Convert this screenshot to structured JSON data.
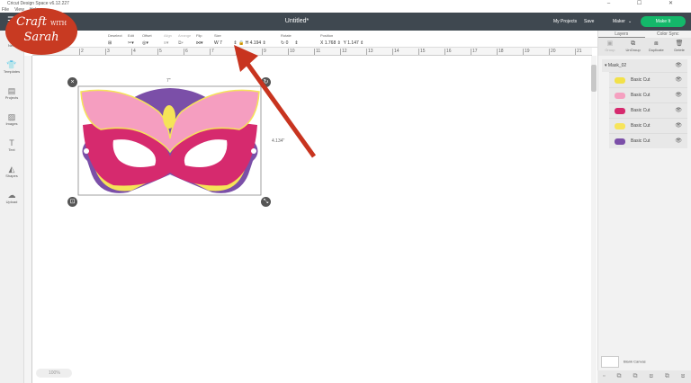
{
  "window": {
    "title": "Cricut Design Space v6.12.227",
    "controls": "– ☐ ✕"
  },
  "menu": [
    "File",
    "View",
    "Help"
  ],
  "header": {
    "title": "Untitled*",
    "my_projects": "My Projects",
    "save": "Save",
    "machine": "Maker",
    "make_it": "Make It",
    "accent": "#14b86a"
  },
  "toolbar": {
    "deselect": "Deselect",
    "edit": "Edit",
    "offset": "Offset",
    "align": "Align",
    "arrange": "Arrange",
    "flip": "Flip",
    "size": "Size",
    "w_label": "W",
    "w": "7",
    "h_label": "H",
    "h": "4.194",
    "rotate": "Rotate",
    "rotate_value": "0",
    "position": "Position",
    "x_label": "X",
    "x": "1.768",
    "y_label": "Y",
    "y": "1.147"
  },
  "ruler": [
    "2",
    "3",
    "4",
    "5",
    "6",
    "7",
    "8",
    "9",
    "10",
    "11",
    "12",
    "13",
    "14",
    "15",
    "16",
    "17",
    "18",
    "19",
    "20",
    "21"
  ],
  "sidebar": [
    {
      "label": "New",
      "icon": "plus-icon"
    },
    {
      "label": "Templates",
      "icon": "shirt-icon"
    },
    {
      "label": "Projects",
      "icon": "projects-icon"
    },
    {
      "label": "Images",
      "icon": "image-icon"
    },
    {
      "label": "Text",
      "icon": "text-icon"
    },
    {
      "label": "Shapes",
      "icon": "shapes-icon"
    },
    {
      "label": "Upload",
      "icon": "upload-icon"
    }
  ],
  "logo": {
    "line1": "Craft",
    "with": "WITH",
    "line2": "Sarah"
  },
  "canvas": {
    "width_dim": "7\"",
    "height_dim": "4.134\"",
    "zoom": "100%"
  },
  "panel": {
    "tabs": [
      "Layers",
      "Color Sync"
    ],
    "tools": [
      "Group",
      "UnGroup",
      "Duplicate",
      "Delete"
    ],
    "group": "Mask_02",
    "layers": [
      {
        "name": "Basic Cut",
        "color": "#f2e14a"
      },
      {
        "name": "Basic Cut",
        "color": "#f5a0c0"
      },
      {
        "name": "Basic Cut",
        "color": "#d62a6e"
      },
      {
        "name": "Basic Cut",
        "color": "#f7e45a"
      },
      {
        "name": "Basic Cut",
        "color": "#7b4fa8"
      }
    ],
    "blank_canvas": "Blank Canvas"
  }
}
